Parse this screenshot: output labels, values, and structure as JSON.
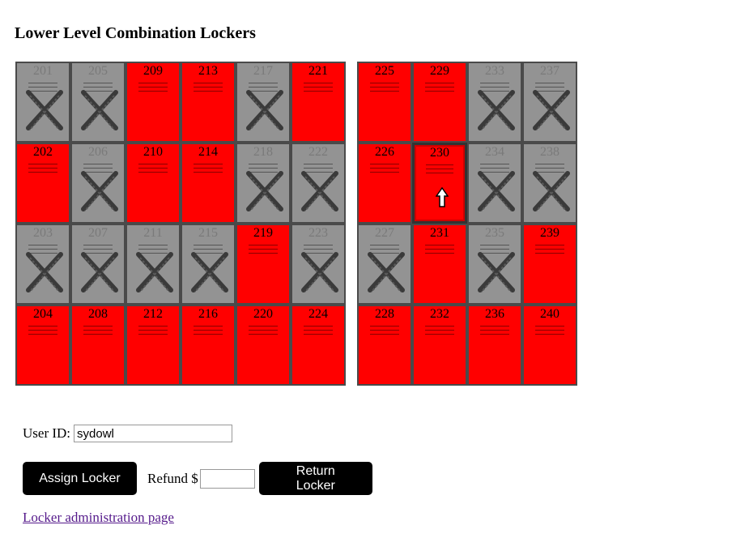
{
  "page": {
    "title": "Lower Level Combination Lockers"
  },
  "lockers": {
    "left": [
      {
        "number": "201",
        "status": "taken"
      },
      {
        "number": "205",
        "status": "taken"
      },
      {
        "number": "209",
        "status": "available"
      },
      {
        "number": "213",
        "status": "available"
      },
      {
        "number": "217",
        "status": "taken"
      },
      {
        "number": "221",
        "status": "available"
      },
      {
        "number": "202",
        "status": "available"
      },
      {
        "number": "206",
        "status": "taken"
      },
      {
        "number": "210",
        "status": "available"
      },
      {
        "number": "214",
        "status": "available"
      },
      {
        "number": "218",
        "status": "taken"
      },
      {
        "number": "222",
        "status": "taken"
      },
      {
        "number": "203",
        "status": "taken"
      },
      {
        "number": "207",
        "status": "taken"
      },
      {
        "number": "211",
        "status": "taken"
      },
      {
        "number": "215",
        "status": "taken"
      },
      {
        "number": "219",
        "status": "available"
      },
      {
        "number": "223",
        "status": "taken"
      },
      {
        "number": "204",
        "status": "available"
      },
      {
        "number": "208",
        "status": "available"
      },
      {
        "number": "212",
        "status": "available"
      },
      {
        "number": "216",
        "status": "available"
      },
      {
        "number": "220",
        "status": "available"
      },
      {
        "number": "224",
        "status": "available"
      }
    ],
    "right": [
      {
        "number": "225",
        "status": "available"
      },
      {
        "number": "229",
        "status": "available"
      },
      {
        "number": "233",
        "status": "taken"
      },
      {
        "number": "237",
        "status": "taken"
      },
      {
        "number": "226",
        "status": "available"
      },
      {
        "number": "230",
        "status": "available",
        "selected": true
      },
      {
        "number": "234",
        "status": "taken"
      },
      {
        "number": "238",
        "status": "taken"
      },
      {
        "number": "227",
        "status": "taken"
      },
      {
        "number": "231",
        "status": "available"
      },
      {
        "number": "235",
        "status": "taken"
      },
      {
        "number": "239",
        "status": "available"
      },
      {
        "number": "228",
        "status": "available"
      },
      {
        "number": "232",
        "status": "available"
      },
      {
        "number": "236",
        "status": "available"
      },
      {
        "number": "240",
        "status": "available"
      }
    ]
  },
  "form": {
    "user_id_label": "User ID:",
    "user_id_value": "sydowl",
    "assign_label": "Assign Locker",
    "refund_label": "Refund $",
    "refund_value": "",
    "return_label": "Return Locker",
    "admin_link": "Locker administration page"
  },
  "colors": {
    "available": "#ff0000",
    "taken": "#939393"
  },
  "icons": {
    "taken": "x-mark-icon",
    "selected": "up-arrow-icon"
  }
}
